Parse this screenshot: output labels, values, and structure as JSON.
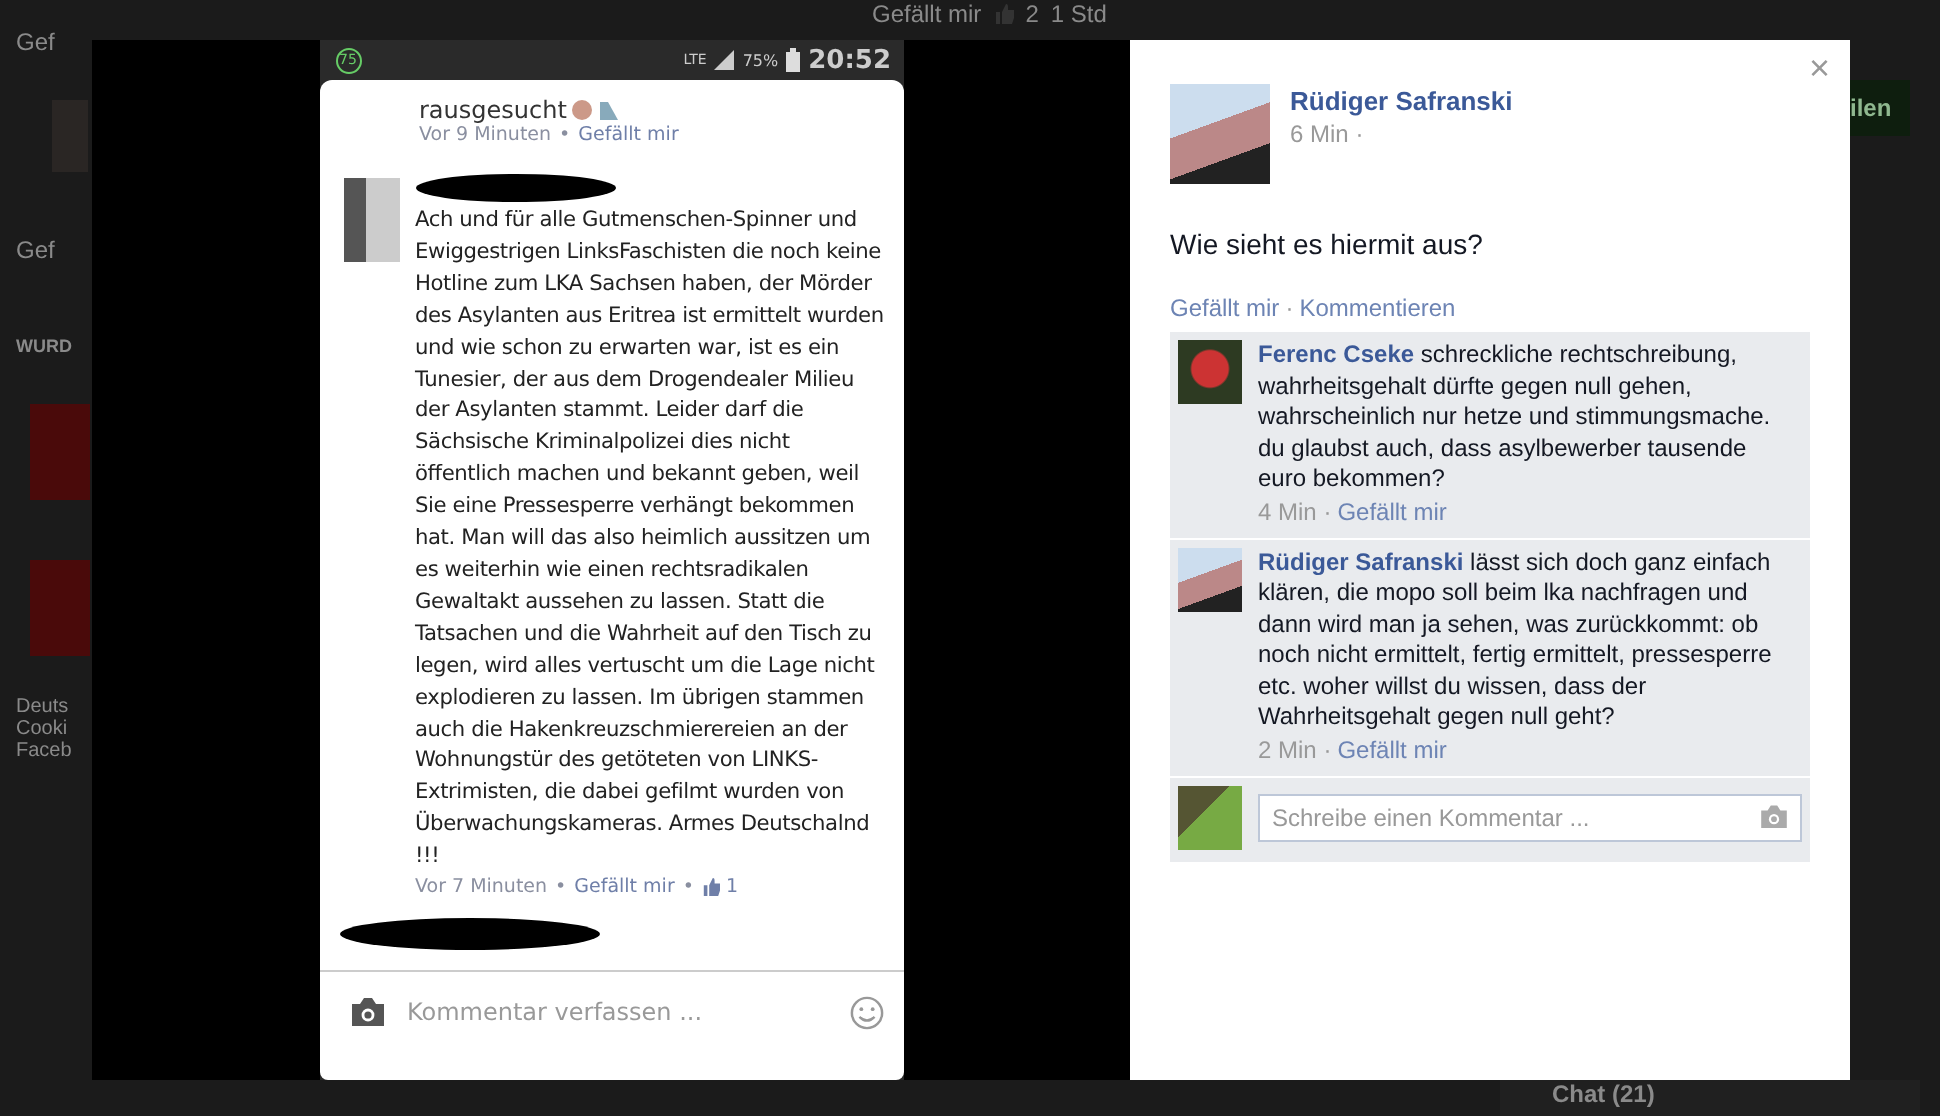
{
  "background": {
    "top_like": "Gefällt mir",
    "top_like_count": "2",
    "top_time": "1 Std",
    "left_links": [
      "Gef",
      "Gef"
    ],
    "section_heading": "WURD",
    "footer_lines": [
      "Deuts",
      "Cooki",
      "Faceb"
    ],
    "share_button": "ilen",
    "chat": "Chat (21)"
  },
  "phone": {
    "status_badge": "75",
    "network": "LTE",
    "battery": "75%",
    "clock": "20:52",
    "separator": "•",
    "post": {
      "author": "rausgesucht",
      "time": "Vor 9 Minuten",
      "like": "Gefällt mir"
    },
    "comment": {
      "text": "Ach und für alle Gutmenschen-Spinner und Ewiggestrigen LinksFaschisten die noch keine Hotline zum LKA Sachsen haben, der Mörder des Asylanten aus Eritrea ist ermittelt wurden und wie schon zu erwarten war, ist es ein Tunesier, der aus dem Drogendealer Milieu der Asylanten stammt. Leider darf die Sächsische Kriminalpolizei dies nicht öffentlich machen und bekannt geben, weil Sie eine Pressesperre verhängt bekommen hat. Man will das also heimlich aussitzen um es weiterhin wie einen rechtsradikalen Gewaltakt aussehen zu lassen. Statt die Tatsachen und die Wahrheit auf den Tisch zu legen, wird alles vertuscht um die Lage nicht explodieren zu lassen. Im übrigen stammen auch die Hakenkreuzschmierereien an der Wohnungstür des getöteten von LINKS-Extrimisten, die dabei gefilmt wurden von Überwachungskameras. Armes Deutschalnd !!!",
      "time": "Vor 7 Minuten",
      "like": "Gefällt mir",
      "likes": "1"
    },
    "input": {
      "placeholder": "Kommentar verfassen ..."
    }
  },
  "panel": {
    "separator": "·",
    "close": "×",
    "author": "Rüdiger Safranski",
    "time": "6 Min",
    "message": "Wie sieht es hiermit aus?",
    "actions": [
      "Gefällt mir",
      "Kommentieren"
    ],
    "comments": [
      {
        "author": "Ferenc Cseke",
        "text": "schreckliche rechtschreibung, wahrheitsgehalt dürfte gegen null gehen, wahrscheinlich nur hetze und stimmungsmache.\ndu glaubst auch, dass asylbewerber tausende euro bekommen?",
        "time": "4 Min",
        "like": "Gefällt mir"
      },
      {
        "author": "Rüdiger Safranski",
        "text": "lässt sich doch ganz einfach klären, die mopo soll beim lka nachfragen und dann wird man ja sehen, was zurückkommt: ob noch nicht ermittelt, fertig ermittelt, pressesperre etc. woher willst du wissen, dass der Wahrheitsgehalt gegen null geht?",
        "time": "2 Min",
        "like": "Gefällt mir"
      }
    ],
    "input": {
      "placeholder": "Schreibe einen Kommentar ..."
    }
  }
}
